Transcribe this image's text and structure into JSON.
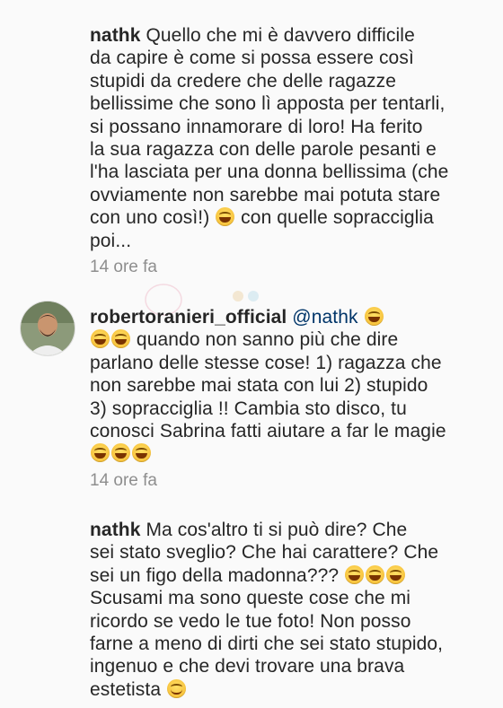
{
  "comments": [
    {
      "username": "nathk",
      "text_lines": "Quello che mi è davvero difficile\nda capire è come si possa essere così\nstupidi da credere che delle ragazze\nbellissime che sono lì apposta per tentarli,\nsi possano innamorare di loro! Ha ferito\nla sua ragazza con delle parole pesanti e\nl'ha lasciata per una donna bellissima (che\novviamente non sarebbe mai potuta stare\ncon uno così!)",
      "tail": " con quelle sopracciglia\npoi...",
      "time": "14 ore fa"
    },
    {
      "username": "robertoranieri_official",
      "mention": "@nathk",
      "text_mid": " quando non sanno più che dire\nparlano delle stesse cose! 1) ragazza che\nnon sarebbe mai stata con lui 2) stupido\n3) sopracciglia !! Cambia sto disco, tu\nconosci Sabrina fatti aiutare a far le magie",
      "time": "14 ore fa"
    },
    {
      "username": "nathk",
      "text_a": "Ma cos'altro ti si può dire? Che\nsei stato sveglio? Che hai carattere? Che\nsei un figo della madonna???",
      "text_b": "Scusami ma sono queste cose che mi\nricordo se vedo le tue foto! Non posso\nfarne a meno di dirti che sei stato stupido,\ningenuo e che devi trovare una brava\nestetista"
    }
  ],
  "icons": {
    "laughing": "face-with-tears-of-joy-icon",
    "wink": "winking-face-icon"
  }
}
